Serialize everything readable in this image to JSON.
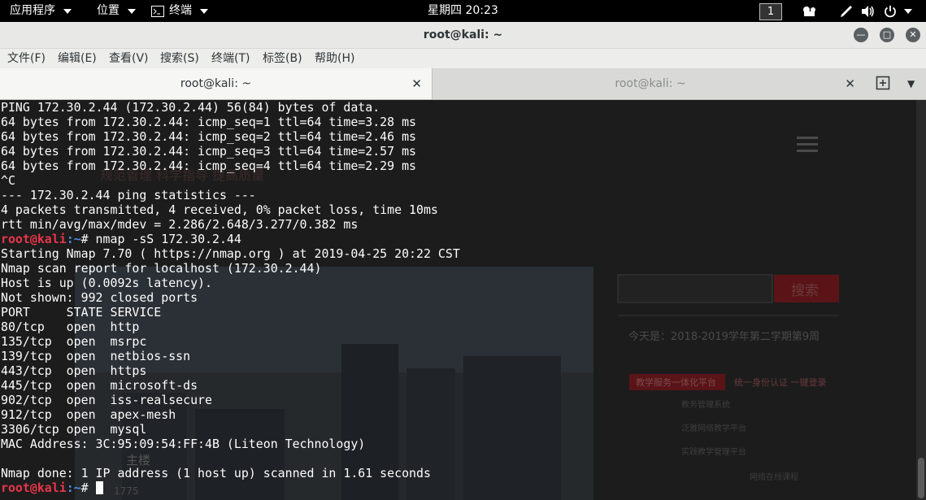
{
  "top_panel": {
    "apps_label": "应用程序",
    "places_label": "位置",
    "terminal_label": "终端",
    "clock": "星期四 20:23",
    "workspace": "1"
  },
  "window": {
    "title": "root@kali: ~"
  },
  "menu": {
    "items": [
      "文件(F)",
      "编辑(E)",
      "查看(V)",
      "搜索(S)",
      "终端(T)",
      "标签(B)",
      "帮助(H)"
    ]
  },
  "tabs": [
    {
      "label": "root@kali: ~",
      "active": true
    },
    {
      "label": "root@kali: ~",
      "active": false
    }
  ],
  "terminal": {
    "prompt_user": "root@kali",
    "prompt_path": ":~",
    "lines": [
      "PING 172.30.2.44 (172.30.2.44) 56(84) bytes of data.",
      "64 bytes from 172.30.2.44: icmp_seq=1 ttl=64 time=3.28 ms",
      "64 bytes from 172.30.2.44: icmp_seq=2 ttl=64 time=2.46 ms",
      "64 bytes from 172.30.2.44: icmp_seq=3 ttl=64 time=2.57 ms",
      "64 bytes from 172.30.2.44: icmp_seq=4 ttl=64 time=2.29 ms",
      "^C",
      "--- 172.30.2.44 ping statistics ---",
      "4 packets transmitted, 4 received, 0% packet loss, time 10ms",
      "rtt min/avg/max/mdev = 2.286/2.648/3.277/0.382 ms"
    ],
    "command": "# nmap -sS 172.30.2.44",
    "output": [
      "Starting Nmap 7.70 ( https://nmap.org ) at 2019-04-25 20:22 CST",
      "Nmap scan report for localhost (172.30.2.44)",
      "Host is up (0.0092s latency).",
      "Not shown: 992 closed ports",
      "PORT     STATE SERVICE",
      "80/tcp   open  http",
      "135/tcp  open  msrpc",
      "139/tcp  open  netbios-ssn",
      "443/tcp  open  https",
      "445/tcp  open  microsoft-ds",
      "902/tcp  open  iss-realsecure",
      "912/tcp  open  apex-mesh",
      "3306/tcp open  mysql",
      "MAC Address: 3C:95:09:54:FF:4B (Liteon Technology)",
      "",
      "Nmap done: 1 IP address (1 host up) scanned in 1.61 seconds"
    ],
    "final_prompt": "# "
  },
  "background_page": {
    "slogan": "规范管理 科学指导 提高质量",
    "search_button": "搜索",
    "date_text": "今天是：2018-2019学年第二学期第9周",
    "platform_title": "教学服务一体化平台",
    "login_text": "统一身份认证 一键登录",
    "links": [
      "教务管理系统",
      "泛雅网络教学平台",
      "实践教学管理平台",
      "网络在线课程"
    ],
    "caption": "主楼",
    "counter": "1775"
  },
  "colors": {
    "prompt_user": "#e8364a",
    "prompt_path": "#4c8cde",
    "terminal_bg": "#1c1c1c",
    "terminal_fg": "#fdfdfd"
  }
}
